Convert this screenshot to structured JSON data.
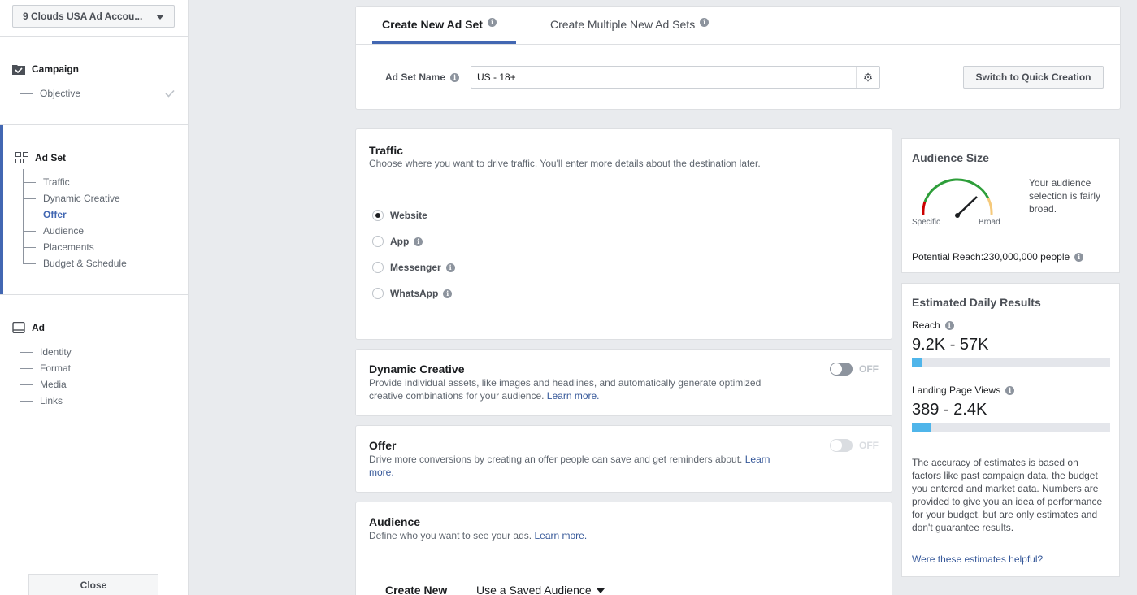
{
  "sidebar": {
    "account": "9 Clouds USA Ad Accou...",
    "campaign": {
      "title": "Campaign",
      "items": [
        {
          "label": "Objective"
        }
      ]
    },
    "adset": {
      "title": "Ad Set",
      "items": [
        {
          "label": "Traffic"
        },
        {
          "label": "Dynamic Creative"
        },
        {
          "label": "Offer"
        },
        {
          "label": "Audience"
        },
        {
          "label": "Placements"
        },
        {
          "label": "Budget & Schedule"
        }
      ]
    },
    "ad": {
      "title": "Ad",
      "items": [
        {
          "label": "Identity"
        },
        {
          "label": "Format"
        },
        {
          "label": "Media"
        },
        {
          "label": "Links"
        }
      ]
    },
    "close": "Close"
  },
  "tabs": [
    {
      "label": "Create New Ad Set"
    },
    {
      "label": "Create Multiple New Ad Sets"
    }
  ],
  "adset_name": {
    "label": "Ad Set Name",
    "value": "US - 18+"
  },
  "quick_creation": "Switch to Quick Creation",
  "traffic": {
    "title": "Traffic",
    "desc": "Choose where you want to drive traffic. You'll enter more details about the destination later.",
    "options": [
      {
        "label": "Website",
        "selected": true
      },
      {
        "label": "App"
      },
      {
        "label": "Messenger"
      },
      {
        "label": "WhatsApp"
      }
    ]
  },
  "dynamic_creative": {
    "title": "Dynamic Creative",
    "desc_line1": "Provide individual assets, like images and headlines, and automatically generate optimized",
    "desc_line2": "creative combinations for your audience.",
    "learn_more": "Learn more.",
    "toggle": "OFF"
  },
  "offer": {
    "title": "Offer",
    "desc": "Drive more conversions by creating an offer people can save and get reminders about.",
    "learn_more_1": "Learn",
    "learn_more_2": "more.",
    "toggle": "OFF"
  },
  "audience": {
    "title": "Audience",
    "desc": "Define who you want to see your ads.",
    "learn_more": "Learn more.",
    "tab_new": "Create New",
    "tab_saved": "Use a Saved Audience"
  },
  "audience_size": {
    "title": "Audience Size",
    "specific": "Specific",
    "broad": "Broad",
    "text": "Your audience selection is fairly broad.",
    "potential_reach": "Potential Reach:230,000,000 people"
  },
  "daily_results": {
    "title": "Estimated Daily Results",
    "reach_label": "Reach",
    "reach_value": "9.2K - 57K",
    "reach_fill": 0.05,
    "lpv_label": "Landing Page Views",
    "lpv_value": "389 - 2.4K",
    "lpv_fill": 0.1,
    "note": "The accuracy of estimates is based on factors like past campaign data, the budget you entered and market data. Numbers are provided to give you an idea of performance for your budget, but are only estimates and don't guarantee results.",
    "helpful": "Were these estimates helpful?"
  },
  "colors": {
    "accent": "#4267b2",
    "bar": "#4fb5ea",
    "link": "#365899"
  }
}
